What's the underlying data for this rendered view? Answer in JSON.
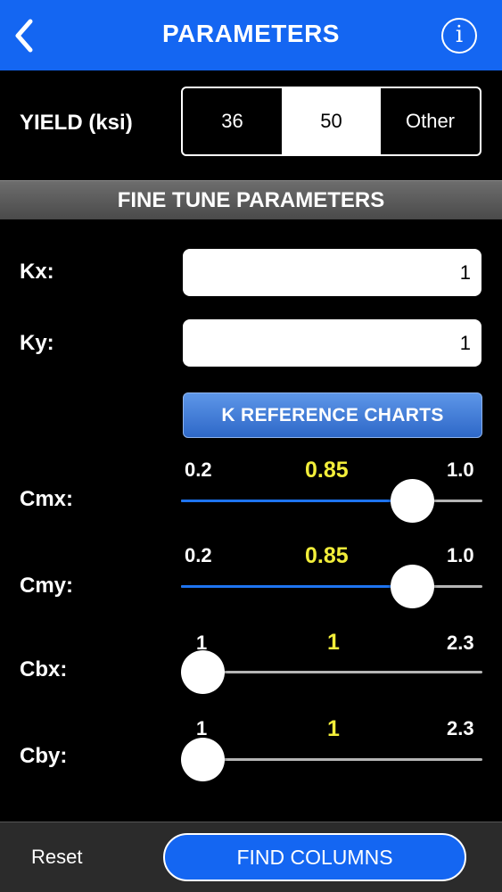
{
  "navbar": {
    "title": "PARAMETERS",
    "back_icon": "chevron-left-icon",
    "info_icon": "info-icon",
    "info_glyph": "i"
  },
  "yield": {
    "label": "YIELD (ksi)",
    "options": [
      "36",
      "50",
      "Other"
    ],
    "selected": "50"
  },
  "section": {
    "title": "FINE TUNE PARAMETERS"
  },
  "kx": {
    "label": "Kx:",
    "value": "1"
  },
  "ky": {
    "label": "Ky:",
    "value": "1"
  },
  "k_reference_button": "K REFERENCE CHARTS",
  "sliders": {
    "cmx": {
      "label": "Cmx:",
      "min": "0.2",
      "max": "1.0",
      "value": "0.85",
      "fraction": 0.8125
    },
    "cmy": {
      "label": "Cmy:",
      "min": "0.2",
      "max": "1.0",
      "value": "0.85",
      "fraction": 0.8125
    },
    "cbx": {
      "label": "Cbx:",
      "min": "1",
      "max": "2.3",
      "value": "1",
      "fraction": 0
    },
    "cby": {
      "label": "Cby:",
      "min": "1",
      "max": "2.3",
      "value": "1",
      "fraction": 0
    }
  },
  "bottom": {
    "reset_label": "Reset",
    "find_label": "FIND COLUMNS"
  },
  "colors": {
    "accent": "#1466f2",
    "slider_value": "#f2ee3a",
    "slider_fill": "#1e74f0"
  }
}
